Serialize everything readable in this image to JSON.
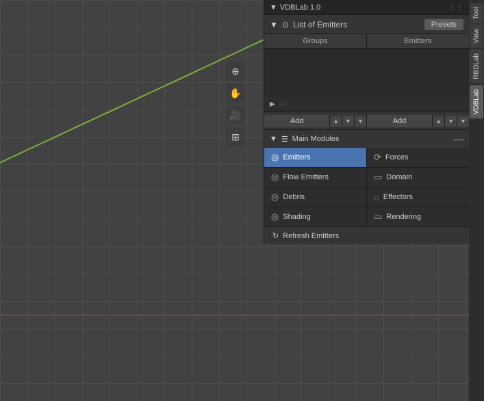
{
  "header": {
    "title": "VDBLab 1.0",
    "dots": "⋮⋮"
  },
  "right_tabs": [
    {
      "id": "tool",
      "label": "Tool"
    },
    {
      "id": "view",
      "label": "View"
    },
    {
      "id": "rbdlab",
      "label": "RBDLab"
    },
    {
      "id": "vdblab",
      "label": "VDBLab",
      "active": true
    }
  ],
  "emitters_panel": {
    "header_icon": "⊙",
    "title": "List of Emitters",
    "presets_label": "Presets",
    "columns": [
      "Groups",
      "Emitters"
    ],
    "add_label": "Add",
    "play_symbol": "▶",
    "drag_dots": "⁞⁞⁞"
  },
  "main_modules": {
    "icon": "☰",
    "title": "Main Modules",
    "collapse_icon": "—",
    "items": [
      {
        "id": "emitters",
        "label": "Emitters",
        "icon": "◎",
        "active": true
      },
      {
        "id": "forces",
        "label": "Forces",
        "icon": "⟳"
      },
      {
        "id": "flow-emitters",
        "label": "Flow Emitters",
        "icon": "◎"
      },
      {
        "id": "domain",
        "label": "Domain",
        "icon": "▭"
      },
      {
        "id": "debris",
        "label": "Debris",
        "icon": "◎"
      },
      {
        "id": "effectors",
        "label": "Effectors",
        "icon": "◌"
      },
      {
        "id": "shading",
        "label": "Shading",
        "icon": "◎"
      },
      {
        "id": "rendering",
        "label": "Rendering",
        "icon": "▭"
      }
    ]
  },
  "refresh": {
    "icon": "↻",
    "label": "Refresh Emitters"
  },
  "toolbar": {
    "icons": [
      "⊕",
      "✋",
      "🎥",
      "⊞"
    ]
  }
}
